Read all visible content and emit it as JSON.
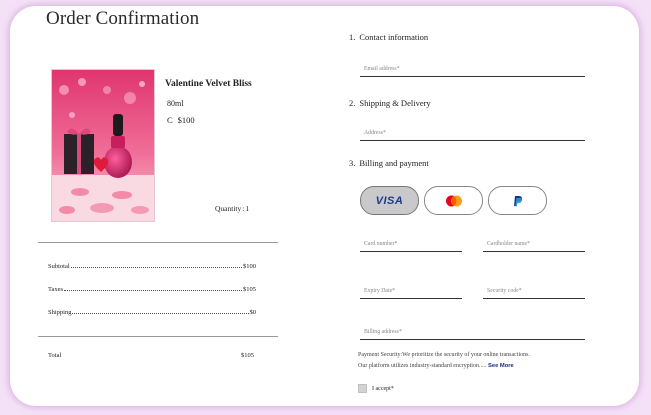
{
  "page": {
    "title": "Order Confirmation"
  },
  "product": {
    "name": "Valentine Velvet Bliss",
    "volume": "80ml",
    "currency": "C",
    "price": "$100",
    "quantity_label": "Quantity",
    "quantity": "1",
    "image_icon": "perfume-photo"
  },
  "summary": {
    "subtotal_label": "Subtotal",
    "subtotal_value": "$100",
    "taxes_label": "Taxes",
    "taxes_value": "$105",
    "shipping_label": "Shipping",
    "shipping_value": "$0",
    "total_label": "Total",
    "total_value": "$105"
  },
  "contact": {
    "number": "1.",
    "heading": "Contact information",
    "email_placeholder": "Email address"
  },
  "shipping": {
    "number": "2.",
    "heading": "Shipping & Delivery",
    "address_placeholder": "Address"
  },
  "billing": {
    "number": "3.",
    "heading": "Billing and payment",
    "visa_label": "VISA",
    "card_number_placeholder": "Card number",
    "cardholder_placeholder": "Cardholder name",
    "expiry_placeholder": "Expiry Date",
    "security_code_placeholder": "Security code",
    "billing_address_placeholder": "Billing address",
    "required_mark": "*"
  },
  "security_note": {
    "line1": "Payment Security:We prioritize the security of your online transactions.",
    "line2": "Our platform utilizes industry-standard encryption.....",
    "more_link": "See More"
  },
  "consent": {
    "label": "I accept",
    "required_mark": "*"
  },
  "colors": {
    "accent": "#f4e1f7",
    "visa_blue": "#1a3a8a",
    "mastercard_red": "#eb001b",
    "mastercard_orange": "#f79e1b",
    "paypal_blue": "#1e2f8a"
  }
}
